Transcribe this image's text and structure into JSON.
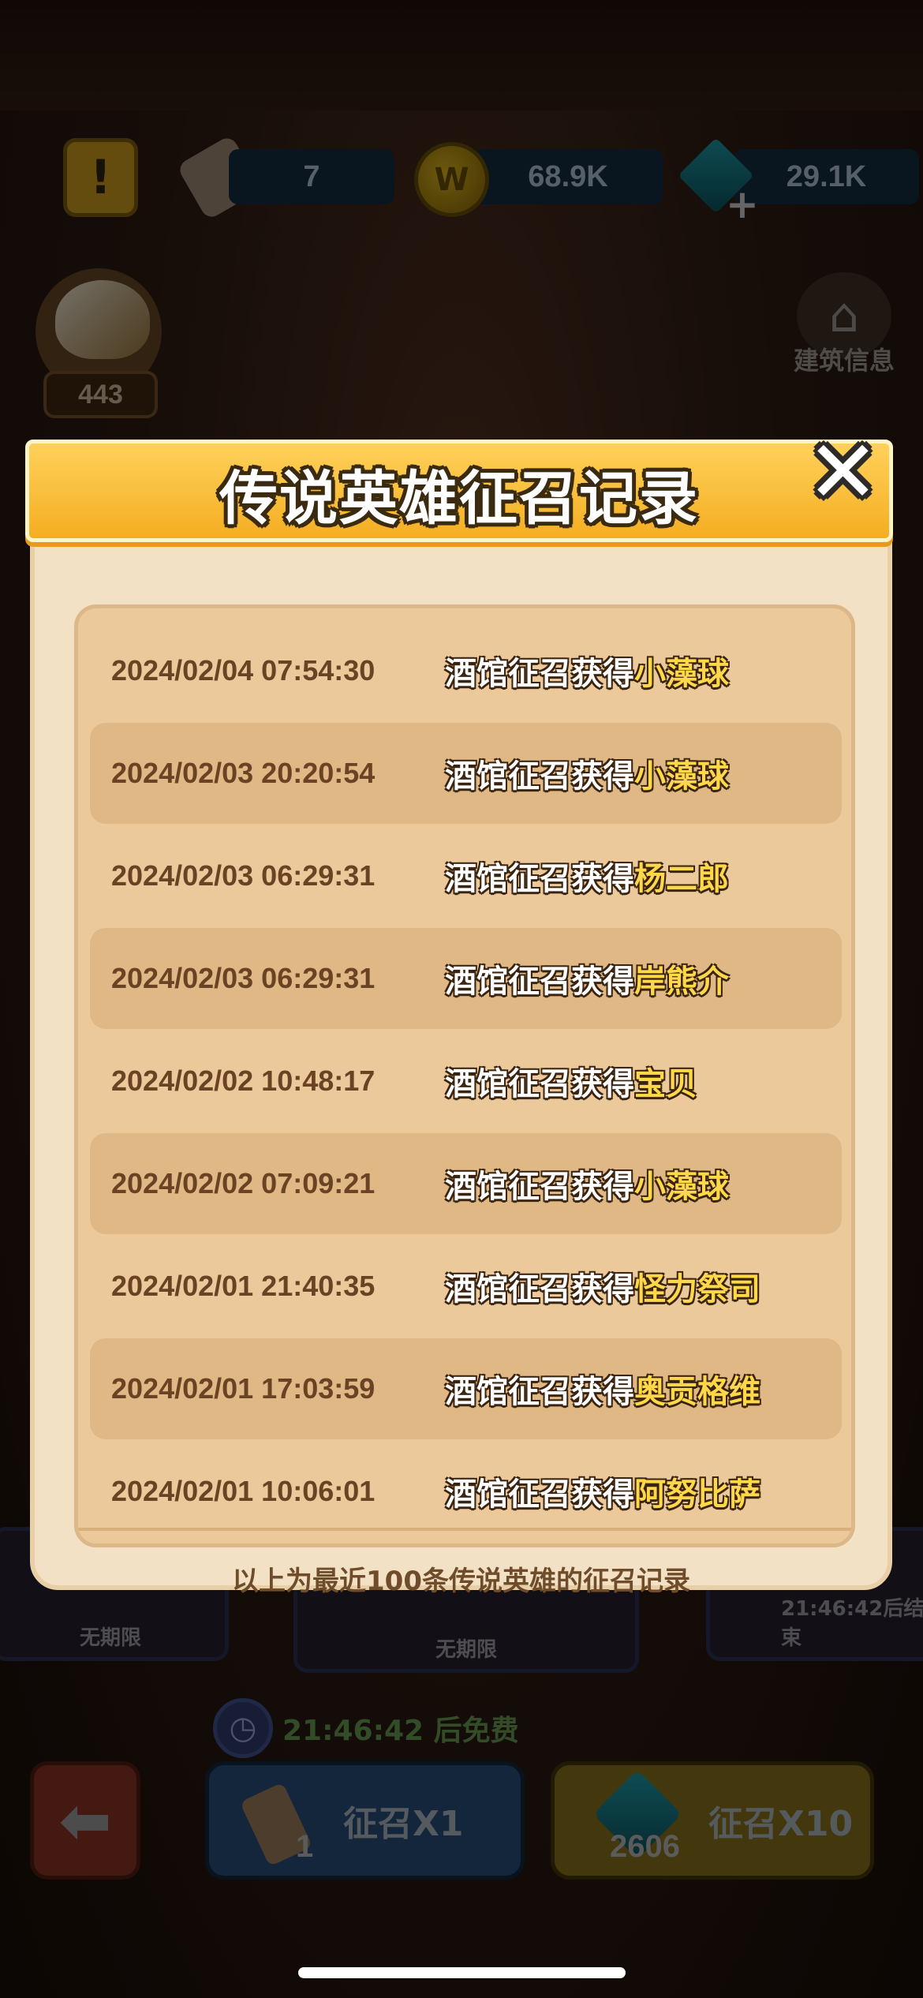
{
  "hud": {
    "scroll_count": "7",
    "coin_count": "68.9K",
    "gem_count": "29.1K",
    "horn_count": "443",
    "building_info_label": "建筑信息"
  },
  "dialog": {
    "title": "传说英雄征召记录",
    "records": [
      {
        "time": "2024/02/04 07:54:30",
        "prefix": "酒馆征召获得",
        "hero": "小藻球"
      },
      {
        "time": "2024/02/03 20:20:54",
        "prefix": "酒馆征召获得",
        "hero": "小藻球"
      },
      {
        "time": "2024/02/03 06:29:31",
        "prefix": "酒馆征召获得",
        "hero": "杨二郎"
      },
      {
        "time": "2024/02/03 06:29:31",
        "prefix": "酒馆征召获得",
        "hero": "岸熊介"
      },
      {
        "time": "2024/02/02 10:48:17",
        "prefix": "酒馆征召获得",
        "hero": "宝贝"
      },
      {
        "time": "2024/02/02 07:09:21",
        "prefix": "酒馆征召获得",
        "hero": "小藻球"
      },
      {
        "time": "2024/02/01 21:40:35",
        "prefix": "酒馆征召获得",
        "hero": "怪力祭司"
      },
      {
        "time": "2024/02/01 17:03:59",
        "prefix": "酒馆征召获得",
        "hero": "奥贡格维"
      },
      {
        "time": "2024/02/01 10:06:01",
        "prefix": "酒馆征召获得",
        "hero": "阿努比萨"
      }
    ],
    "footer_note": "以上为最近100条传说英雄的征召记录"
  },
  "background_cards": {
    "left_label": "无期限",
    "center_label": "无期限",
    "right_label": "21:46:42后结束"
  },
  "free_timer": "21:46:42 后免费",
  "buttons": {
    "summon_x1_label": "征召X1",
    "summon_x1_cost": "1",
    "summon_x10_label": "征召X10",
    "summon_x10_cost": "2606"
  },
  "colors": {
    "header_gold": "#f4ae22",
    "panel_bg": "#ebc99b",
    "row_alt": "#dfb885",
    "hero_name": "#ffd84a",
    "time_text": "#6a4325"
  }
}
